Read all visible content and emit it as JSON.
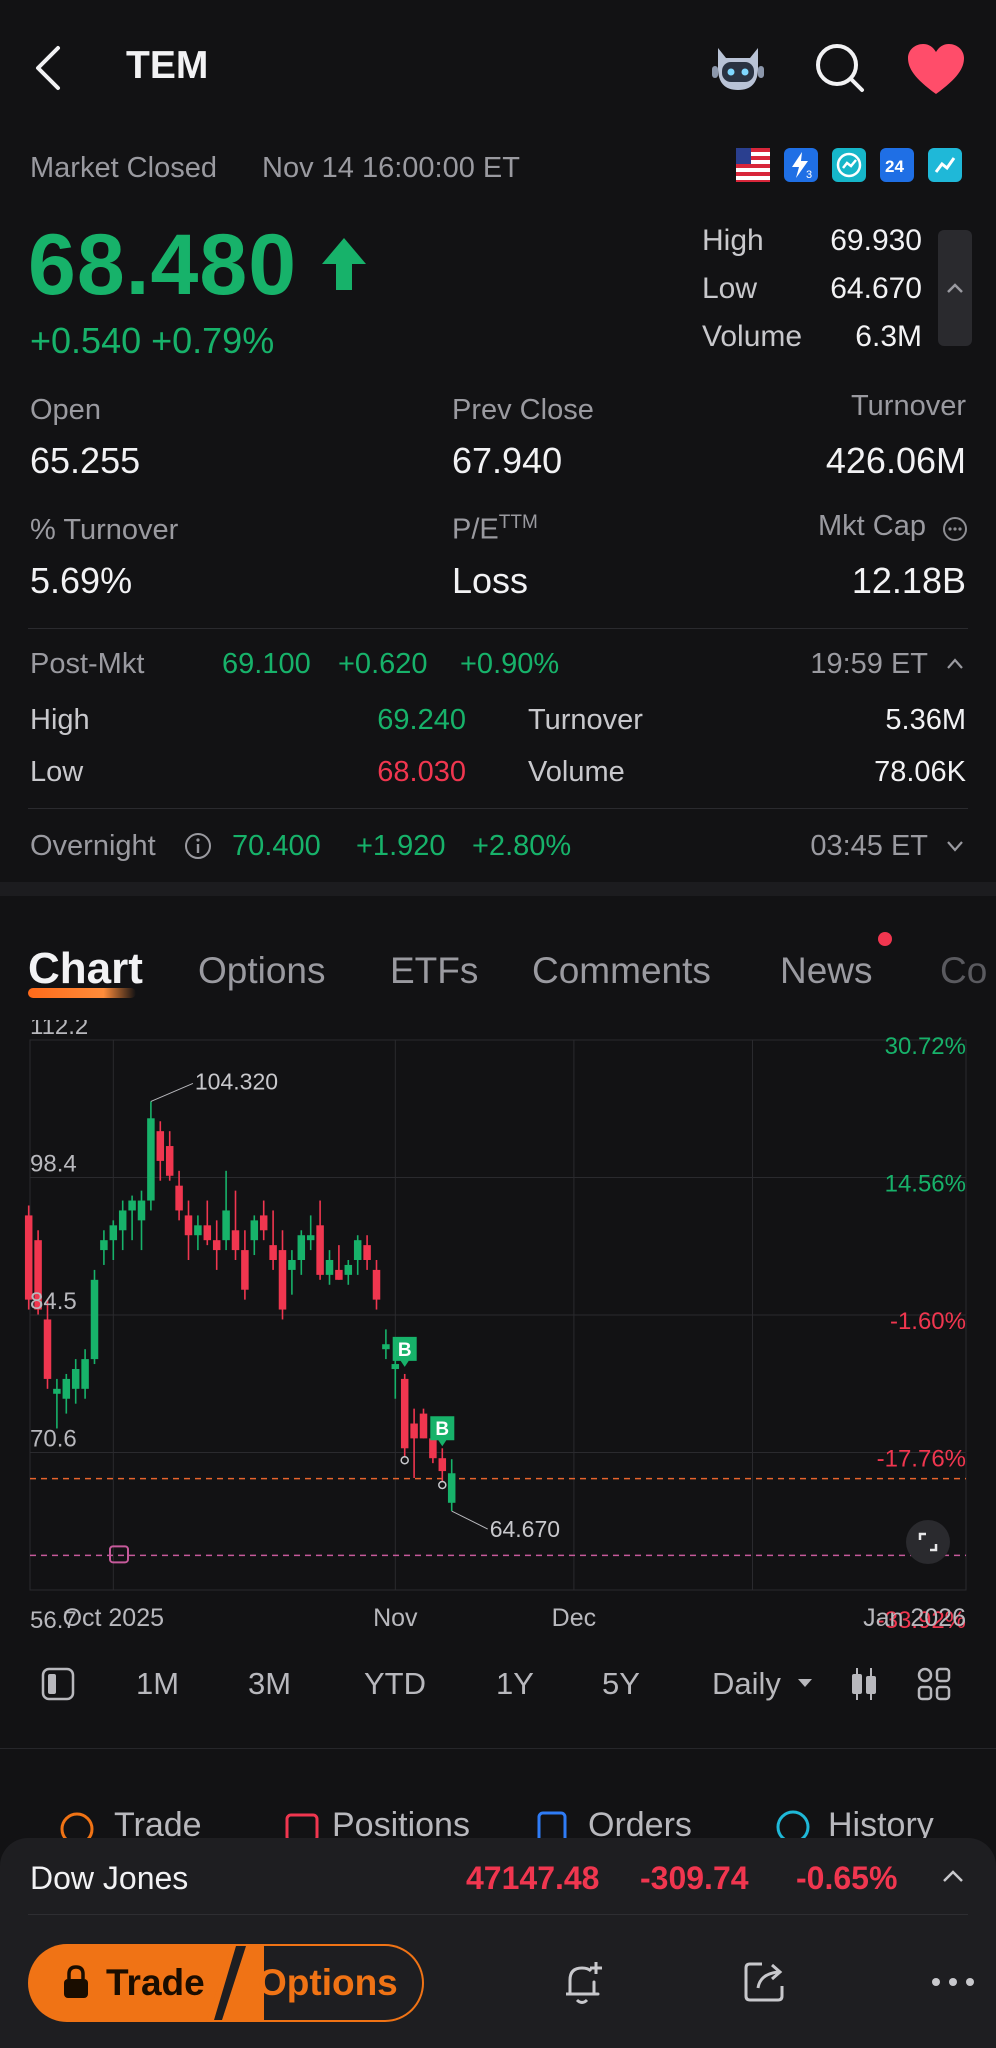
{
  "header": {
    "ticker": "TEM"
  },
  "status": {
    "market_state": "Market Closed",
    "datetime": "Nov 14 16:00:00 ET"
  },
  "badges": [
    "us-flag-icon",
    "lightning-3-icon",
    "chart-circle-icon",
    "24-hour-icon",
    "lightning-chart-icon"
  ],
  "quote": {
    "price": "68.480",
    "change": "+0.540 +0.79%",
    "high_label": "High",
    "high": "69.930",
    "low_label": "Low",
    "low": "64.670",
    "volume_label": "Volume",
    "volume": "6.3M"
  },
  "stats": {
    "open_label": "Open",
    "open": "65.255",
    "prev_close_label": "Prev Close",
    "prev_close": "67.940",
    "turnover_label": "Turnover",
    "turnover": "426.06M",
    "pct_turnover_label": "% Turnover",
    "pct_turnover": "5.69%",
    "pe_label": "P/E",
    "pe_sup": "TTM",
    "pe": "Loss",
    "mkt_cap_label": "Mkt Cap",
    "mkt_cap": "12.18B"
  },
  "post_market": {
    "label": "Post-Mkt",
    "price": "69.100",
    "change": "+0.620",
    "pct": "+0.90%",
    "time": "19:59 ET",
    "high_label": "High",
    "high": "69.240",
    "low_label": "Low",
    "low": "68.030",
    "turnover_label": "Turnover",
    "turnover": "5.36M",
    "volume_label": "Volume",
    "volume": "78.06K"
  },
  "overnight": {
    "label": "Overnight",
    "price": "70.400",
    "change": "+1.920",
    "pct": "+2.80%",
    "time": "03:45 ET"
  },
  "tabs": [
    "Chart",
    "Options",
    "ETFs",
    "Comments",
    "News",
    "Co"
  ],
  "chart_data": {
    "type": "candlestick",
    "y_ticks_left": [
      "112.2",
      "98.4",
      "84.5",
      "70.6",
      "56.7"
    ],
    "y_ticks_right": [
      "30.72%",
      "14.56%",
      "-1.60%",
      "-17.76%",
      "-33.92%"
    ],
    "x_ticks": [
      "Oct 2025",
      "Nov",
      "Dec",
      "Jan 2026"
    ],
    "ylim": [
      56.7,
      112.2
    ],
    "annotations": {
      "high": "104.320",
      "low": "64.670",
      "buy_marker": "B"
    },
    "reference_lines": {
      "prev_close": 67.94,
      "cost": 60.2
    },
    "candles": [
      {
        "o": 94.5,
        "h": 95.5,
        "l": 85.0,
        "c": 86.0
      },
      {
        "o": 92.0,
        "h": 93.0,
        "l": 84.5,
        "c": 85.0
      },
      {
        "o": 84.0,
        "h": 86.0,
        "l": 77.0,
        "c": 78.0
      },
      {
        "o": 76.5,
        "h": 78.0,
        "l": 73.0,
        "c": 77.0
      },
      {
        "o": 76.0,
        "h": 78.5,
        "l": 74.5,
        "c": 78.0
      },
      {
        "o": 77.0,
        "h": 80.0,
        "l": 75.5,
        "c": 79.0
      },
      {
        "o": 77.0,
        "h": 81.0,
        "l": 76.0,
        "c": 80.0
      },
      {
        "o": 80.0,
        "h": 89.0,
        "l": 79.5,
        "c": 88.0
      },
      {
        "o": 91.0,
        "h": 93.0,
        "l": 89.5,
        "c": 92.0
      },
      {
        "o": 92.0,
        "h": 94.0,
        "l": 90.0,
        "c": 93.5
      },
      {
        "o": 93.0,
        "h": 96.0,
        "l": 91.0,
        "c": 95.0
      },
      {
        "o": 95.0,
        "h": 96.5,
        "l": 92.0,
        "c": 96.0
      },
      {
        "o": 94.0,
        "h": 97.0,
        "l": 91.0,
        "c": 96.0
      },
      {
        "o": 96.0,
        "h": 106.0,
        "l": 95.0,
        "c": 104.3
      },
      {
        "o": 103.0,
        "h": 104.0,
        "l": 98.0,
        "c": 100.0
      },
      {
        "o": 101.5,
        "h": 103.0,
        "l": 98.0,
        "c": 98.5
      },
      {
        "o": 97.5,
        "h": 99.0,
        "l": 94.0,
        "c": 95.0
      },
      {
        "o": 94.5,
        "h": 96.0,
        "l": 90.0,
        "c": 92.5
      },
      {
        "o": 92.5,
        "h": 94.5,
        "l": 91.0,
        "c": 93.5
      },
      {
        "o": 93.5,
        "h": 96.0,
        "l": 91.5,
        "c": 92.0
      },
      {
        "o": 92.0,
        "h": 94.0,
        "l": 89.0,
        "c": 91.0
      },
      {
        "o": 92.0,
        "h": 99.0,
        "l": 91.0,
        "c": 95.0
      },
      {
        "o": 93.0,
        "h": 97.0,
        "l": 90.0,
        "c": 91.0
      },
      {
        "o": 91.0,
        "h": 93.0,
        "l": 86.0,
        "c": 87.0
      },
      {
        "o": 92.0,
        "h": 94.5,
        "l": 90.5,
        "c": 94.0
      },
      {
        "o": 94.5,
        "h": 96.0,
        "l": 92.0,
        "c": 93.0
      },
      {
        "o": 91.5,
        "h": 95.0,
        "l": 89.0,
        "c": 90.0
      },
      {
        "o": 91.0,
        "h": 93.0,
        "l": 84.0,
        "c": 85.0
      },
      {
        "o": 89.0,
        "h": 91.0,
        "l": 86.5,
        "c": 90.0
      },
      {
        "o": 90.0,
        "h": 93.0,
        "l": 88.5,
        "c": 92.5
      },
      {
        "o": 92.0,
        "h": 94.5,
        "l": 91.0,
        "c": 92.5
      },
      {
        "o": 93.5,
        "h": 96.0,
        "l": 88.0,
        "c": 88.5
      },
      {
        "o": 88.5,
        "h": 91.0,
        "l": 87.5,
        "c": 90.0
      },
      {
        "o": 89.0,
        "h": 91.5,
        "l": 88.0,
        "c": 88.0
      },
      {
        "o": 88.5,
        "h": 90.0,
        "l": 87.5,
        "c": 89.5
      },
      {
        "o": 90.0,
        "h": 92.5,
        "l": 88.5,
        "c": 92.0
      },
      {
        "o": 91.5,
        "h": 92.5,
        "l": 89.0,
        "c": 90.0
      },
      {
        "o": 89.0,
        "h": 90.0,
        "l": 85.0,
        "c": 86.0
      },
      {
        "o": 81.0,
        "h": 83.0,
        "l": 80.0,
        "c": 81.5
      },
      {
        "o": 79.0,
        "h": 80.5,
        "l": 76.0,
        "c": 79.5
      },
      {
        "o": 78.0,
        "h": 78.5,
        "l": 70.0,
        "c": 71.0
      },
      {
        "o": 73.5,
        "h": 75.0,
        "l": 68.0,
        "c": 72.0
      },
      {
        "o": 74.5,
        "h": 75.0,
        "l": 72.0,
        "c": 72.0
      },
      {
        "o": 72.0,
        "h": 73.0,
        "l": 69.5,
        "c": 70.0
      },
      {
        "o": 70.0,
        "h": 71.0,
        "l": 67.5,
        "c": 68.7
      },
      {
        "o": 65.5,
        "h": 69.9,
        "l": 64.67,
        "c": 68.48
      }
    ]
  },
  "periods": [
    "1M",
    "3M",
    "YTD",
    "1Y",
    "5Y",
    "Daily"
  ],
  "trade_bar": [
    "Trade",
    "Positions",
    "Orders",
    "History"
  ],
  "index": {
    "name": "Dow Jones",
    "value": "47147.48",
    "change": "-309.74",
    "pct": "-0.65%"
  },
  "actions": {
    "trade": "Trade",
    "options": "Options"
  },
  "colors": {
    "up": "#17b26a",
    "down": "#f0364f",
    "accent": "#f07315",
    "background": "#121214"
  }
}
